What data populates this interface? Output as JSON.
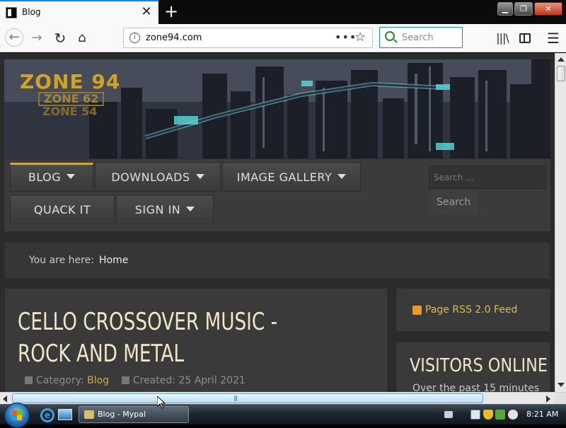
{
  "browser": {
    "tab_title": "Blog",
    "new_tab_symbol": "+",
    "url": "zone94.com",
    "url_more_dots": "•••",
    "search_placeholder": "Search",
    "icons": {
      "back": "back-arrow-icon",
      "forward": "forward-arrow-icon",
      "reload": "reload-icon",
      "home": "home-icon",
      "library": "library-icon",
      "sidebar": "sidebar-icon",
      "menu": "hamburger-menu-icon",
      "bookmark": "star-icon",
      "info": "info-icon"
    },
    "accent_color": "#0a84ff"
  },
  "site": {
    "logo": {
      "primary": "ZONE 94",
      "secondary": "ZONE 62",
      "tertiary": "ZONE 54"
    },
    "nav": {
      "blog": "BLOG",
      "downloads": "DOWNLOADS",
      "image_gallery": "IMAGE GALLERY",
      "quack_it": "QUACK IT",
      "sign_in": "SIGN IN"
    },
    "search": {
      "placeholder": "Search ...",
      "button": "Search"
    },
    "breadcrumb": {
      "label": "You are here:",
      "current": "Home"
    },
    "article": {
      "title": "CELLO CROSSOVER MUSIC - ROCK AND METAL",
      "category_label": "Category:",
      "category": "Blog",
      "created": "Created: 25 April 2021"
    },
    "sidebar": {
      "rss_feed": "Page RSS 2.0 Feed",
      "visitors_heading": "VISITORS ONLINE",
      "visitors_sub": "Over the past 15 minutes"
    },
    "colors": {
      "accent_gold": "#c8a849",
      "background": "#2b2b2b"
    }
  },
  "taskbar": {
    "task_label": "Blog - Mypal",
    "clock": "8:21 AM"
  }
}
